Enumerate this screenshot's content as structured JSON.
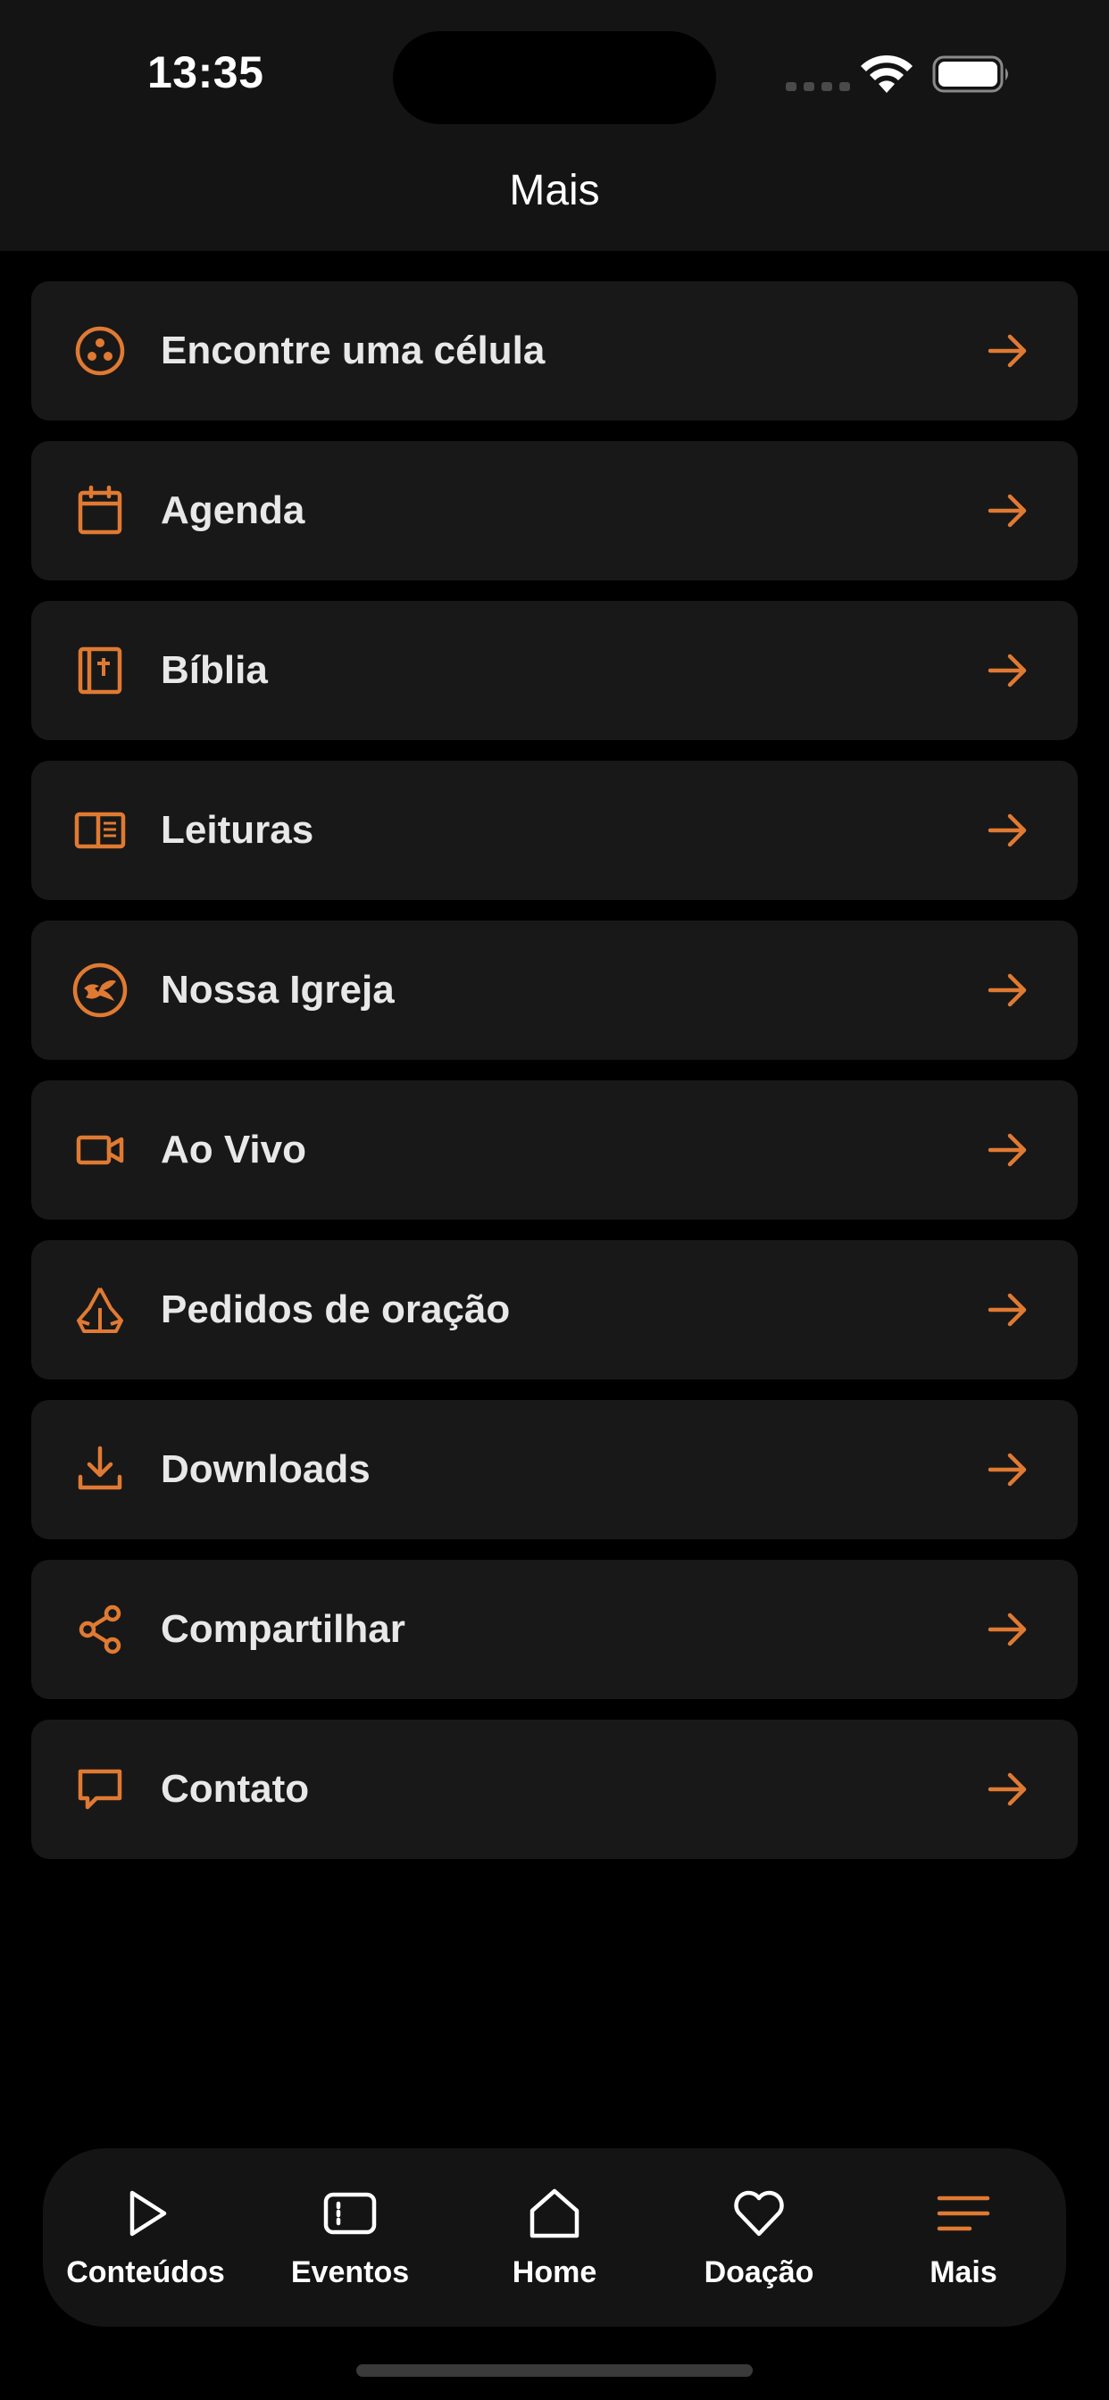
{
  "status_bar": {
    "time": "13:35"
  },
  "header": {
    "title": "Mais"
  },
  "colors": {
    "accent": "#E07A33",
    "background": "#000000",
    "header_bg": "#141414",
    "card_bg": "#181818"
  },
  "menu": {
    "items": [
      {
        "label": "Encontre uma célula",
        "icon": "cell-group-icon"
      },
      {
        "label": "Agenda",
        "icon": "calendar-icon"
      },
      {
        "label": "Bíblia",
        "icon": "bible-icon"
      },
      {
        "label": "Leituras",
        "icon": "book-open-icon"
      },
      {
        "label": "Nossa Igreja",
        "icon": "church-logo-icon"
      },
      {
        "label": "Ao Vivo",
        "icon": "video-camera-icon"
      },
      {
        "label": "Pedidos de oração",
        "icon": "praying-hands-icon"
      },
      {
        "label": "Downloads",
        "icon": "download-icon"
      },
      {
        "label": "Compartilhar",
        "icon": "share-icon"
      },
      {
        "label": "Contato",
        "icon": "chat-bubble-icon"
      }
    ]
  },
  "tabbar": {
    "tabs": [
      {
        "label": "Conteúdos",
        "icon": "play-icon"
      },
      {
        "label": "Eventos",
        "icon": "ticket-icon"
      },
      {
        "label": "Home",
        "icon": "home-icon"
      },
      {
        "label": "Doação",
        "icon": "heart-icon"
      },
      {
        "label": "Mais",
        "icon": "menu-lines-icon",
        "active": true
      }
    ]
  }
}
